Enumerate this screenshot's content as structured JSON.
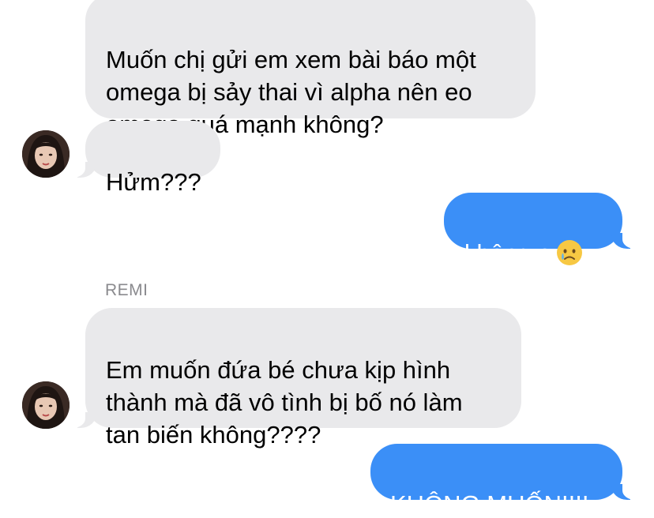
{
  "conversation": {
    "messages": [
      {
        "side": "incoming",
        "text": "Muốn chị gửi em xem bài báo một\nomega bị sảy thai vì alpha nên eo\nomega quá mạnh không?"
      },
      {
        "side": "incoming",
        "text": "Hửm???"
      },
      {
        "side": "outgoing",
        "text": "không ạ",
        "emoji": "crying-face-emoji"
      },
      {
        "side": "incoming",
        "sender": "REMI",
        "text": "Em muốn đứa bé chưa kịp hình\nthành mà đã vô tình bị bố nó làm\ntan biến không????"
      },
      {
        "side": "outgoing",
        "text": "KHÔNG MUỐN!!!!"
      }
    ]
  },
  "colors": {
    "incoming_bubble": "#e9e9eb",
    "outgoing_bubble": "#3b8ff7",
    "sender_label": "#8a8a8e"
  }
}
